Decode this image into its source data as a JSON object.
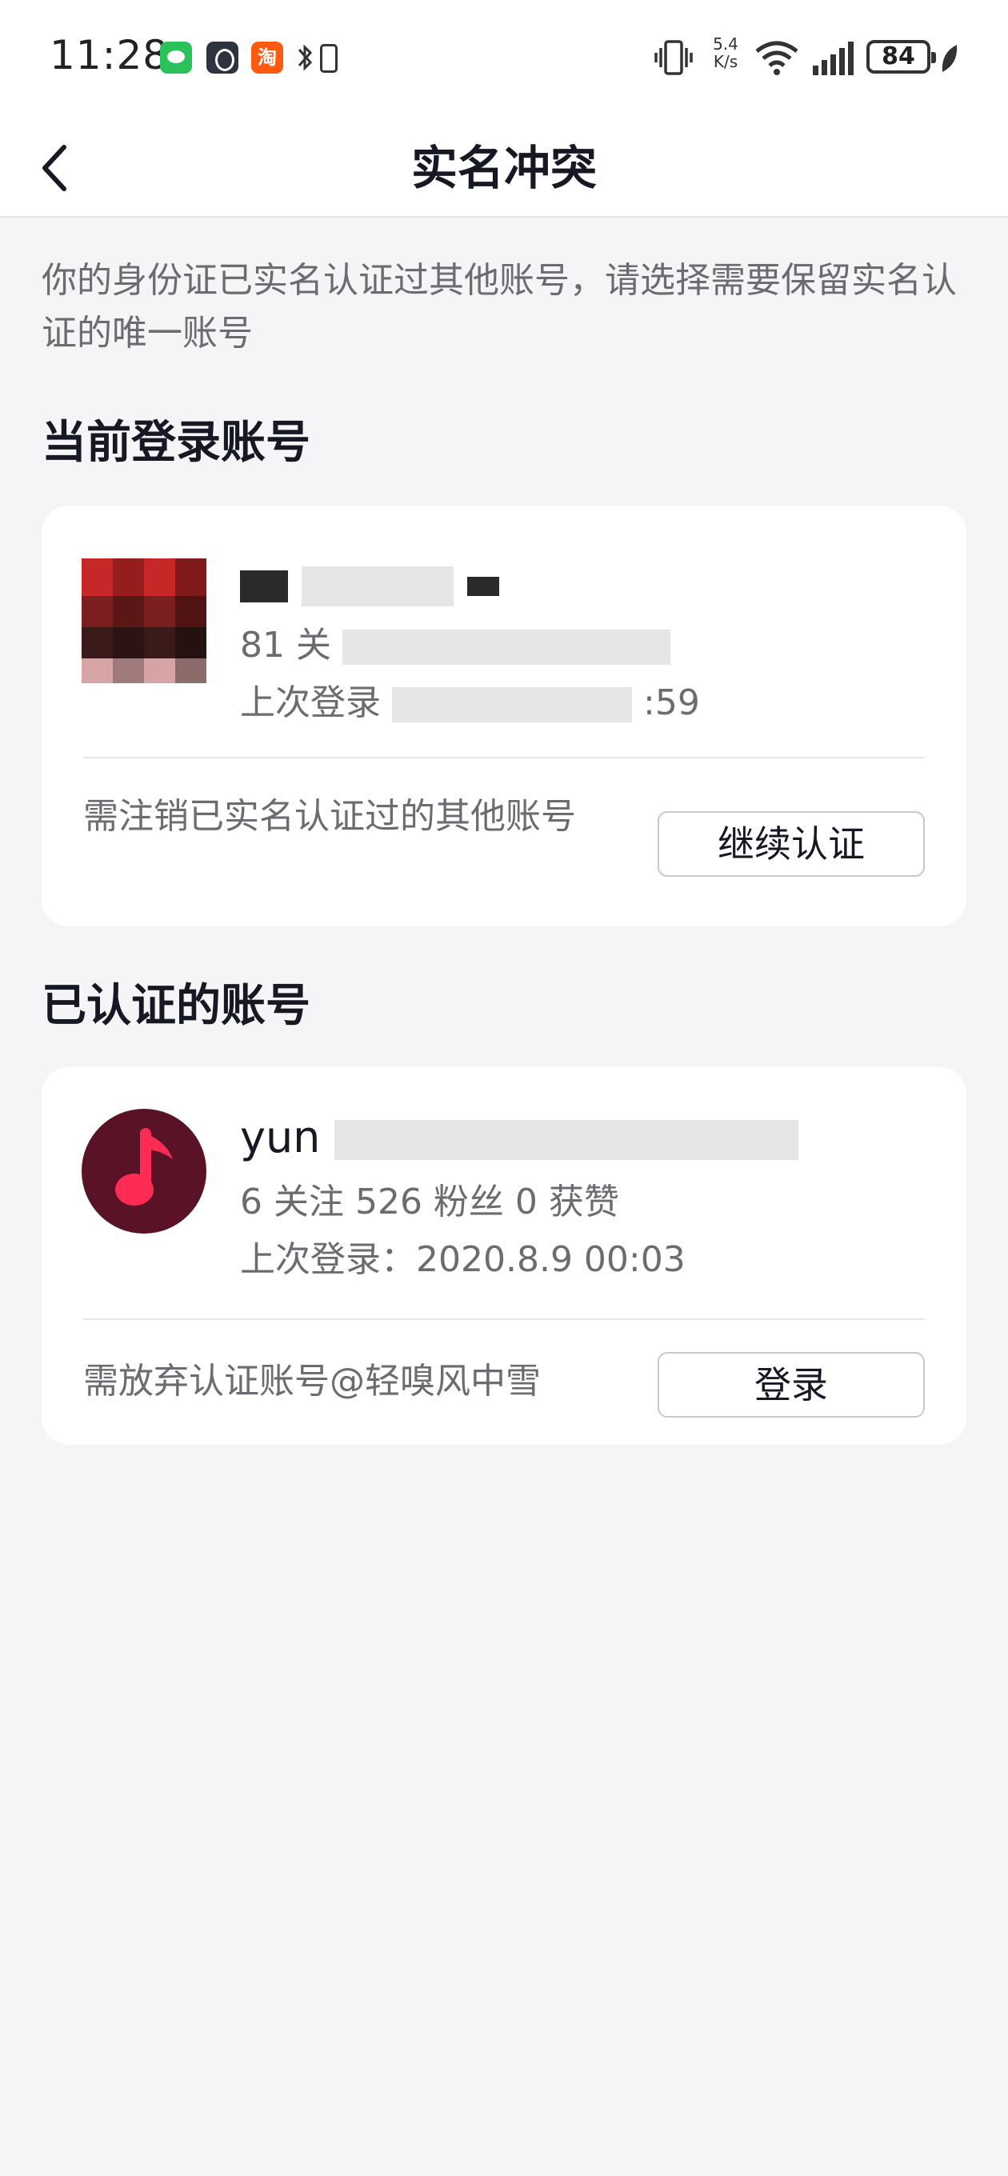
{
  "status_bar": {
    "time": "11:28",
    "net_speed": "5.4 K/s",
    "battery": "84",
    "icons": [
      "wechat-icon",
      "soul-icon",
      "taobao-icon",
      "bluetooth-icon",
      "battery-case-icon",
      "vibrate-icon",
      "wifi-icon",
      "signal-icon",
      "battery-icon",
      "leaf-icon"
    ],
    "taobao_glyph": "淘"
  },
  "nav": {
    "title": "实名冲突"
  },
  "description": "你的身份证已实名认证过其他账号，请选择需要保留实名认证的唯一账号",
  "current_section": {
    "title": "当前登录账号",
    "account": {
      "name_visible": "",
      "stats_prefix": "81 关",
      "login_prefix": "上次登录",
      "login_suffix": ":59"
    },
    "note": "需注销已实名认证过的其他账号",
    "button": "继续认证"
  },
  "verified_section": {
    "title": "已认证的账号",
    "account": {
      "name_prefix": "yun",
      "stats": "6 关注   526 粉丝   0 获赞",
      "last_login": "上次登录：2020.8.9 00:03"
    },
    "note": "需放弃认证账号@轻嗅风中雪",
    "button": "登录"
  },
  "colors": {
    "page_bg": "#f5f5f7",
    "card_bg": "#ffffff",
    "text_primary": "#161823",
    "text_secondary": "#6b6c72",
    "music_avatar_bg": "#5a1326",
    "music_note": "#fe2c55"
  }
}
